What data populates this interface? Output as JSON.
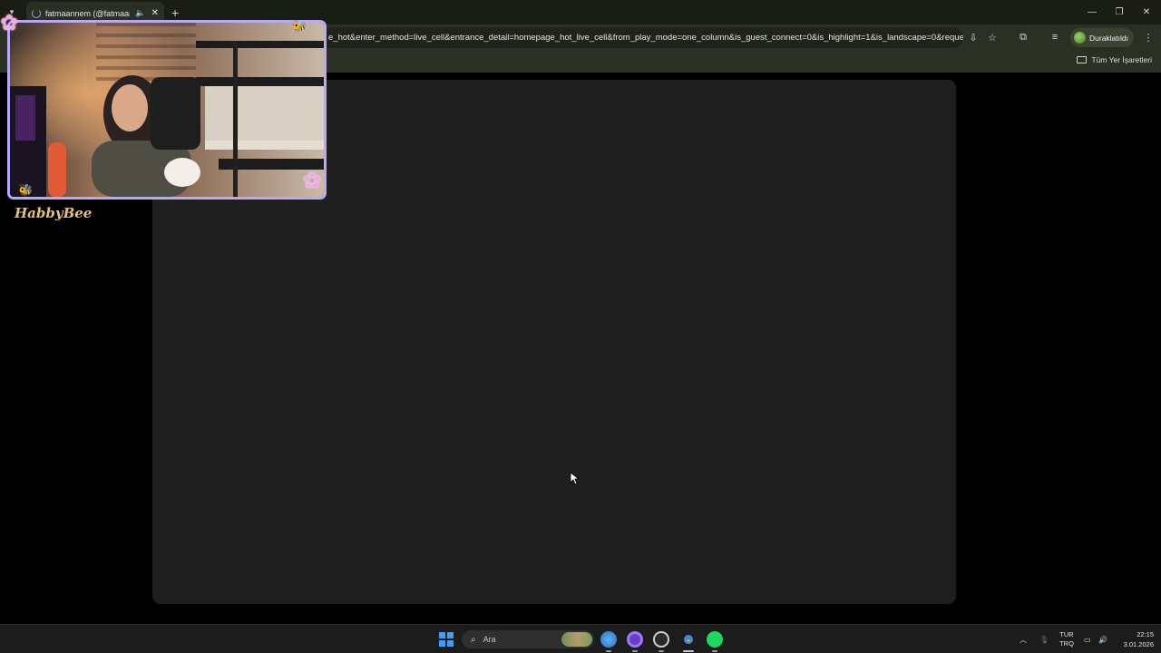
{
  "browser": {
    "tab": {
      "title": "fatmaannem (@fatmaannem",
      "audio_icon": "speaker-icon",
      "close_icon": "close-icon"
    },
    "new_tab_label": "+",
    "window_controls": {
      "minimize": "—",
      "restore": "❐",
      "close": "✕"
    },
    "address": "e_hot&enter_method=live_cell&entrance_detail=homepage_hot_live_cell&from_play_mode=one_column&is_guest_connect=0&is_highlight=1&is_landscape=0&reques...",
    "profile_label": "Duraklatıldı",
    "bookmarks": {
      "all_bookmarks_label": "Tüm Yer İşaretleri"
    }
  },
  "overlay": {
    "streamer_label": "HabbyBee",
    "frame_color": "#b9a8f4"
  },
  "taskbar": {
    "search_placeholder": "Ara",
    "lang_top": "TUR",
    "lang_bottom": "TRQ",
    "time": "22:15",
    "date": "3.01.2026"
  },
  "colors": {
    "tab_strip": "#1a1d14",
    "toolbar": "#2b3024",
    "player_bg": "#1f1f1f",
    "page_bg": "#000000",
    "taskbar": "#1c1c1c"
  }
}
